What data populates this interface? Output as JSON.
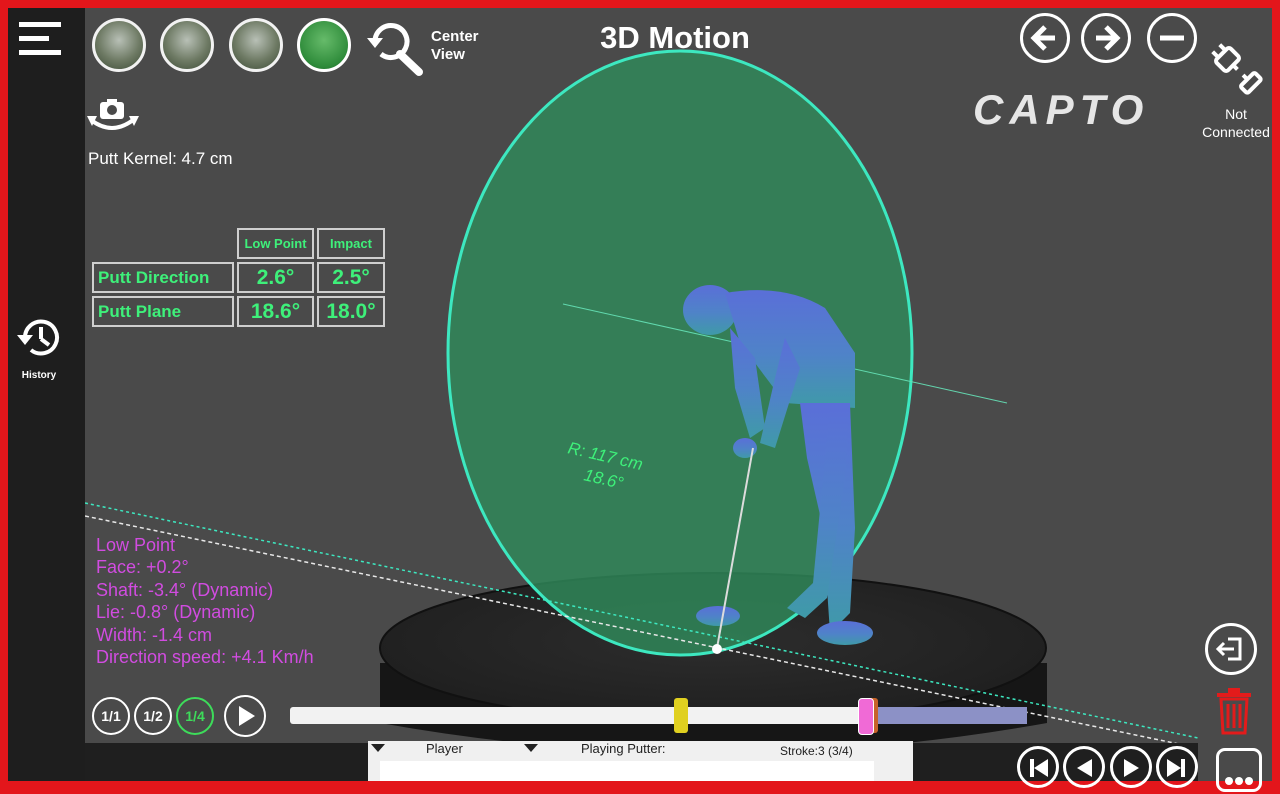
{
  "app": {
    "title": "3D Motion",
    "brand": "CAPTO",
    "connection_status": "Not Connected"
  },
  "toolbar": {
    "center_view_label": "Center View"
  },
  "sidebar": {
    "history_label": "History"
  },
  "readout": {
    "putt_kernel": "Putt Kernel: 4.7 cm"
  },
  "metrics_table": {
    "headers": [
      "Low Point",
      "Impact"
    ],
    "rows": [
      {
        "label": "Putt Direction",
        "values": [
          "2.6°",
          "2.5°"
        ]
      },
      {
        "label": "Putt Plane",
        "values": [
          "18.6°",
          "18.0°"
        ]
      }
    ]
  },
  "plane_annotation": {
    "radius": "R: 117 cm",
    "angle": "18.6°"
  },
  "low_point_info": {
    "title": "Low Point",
    "lines": [
      "Face: +0.2°",
      "Shaft: -3.4° (Dynamic)",
      "Lie: -0.8° (Dynamic)",
      "Width: -1.4 cm",
      "Direction speed: +4.1 Km/h"
    ]
  },
  "playback": {
    "speeds": [
      "1/1",
      "1/2",
      "1/4"
    ],
    "active_speed": "1/4",
    "timeline_position": 0.78
  },
  "bottom_panel": {
    "player_label": "Player",
    "putter_label": "Playing Putter:",
    "stroke_label": "Stroke:3 (3/4)"
  },
  "icons": {
    "menu": "hamburger-menu-icon",
    "camera": "rotate-camera-icon",
    "search": "center-view-search-icon",
    "back": "arrow-left-icon",
    "forward": "arrow-right-icon",
    "remove": "minus-icon",
    "plug": "unplugged-icon",
    "history": "history-clock-icon",
    "exit": "exit-icon",
    "delete": "trash-icon"
  },
  "colors": {
    "plane_fill": "#2f8a5a",
    "plane_edge": "#3de8c0",
    "metric_text": "#3ef07a",
    "info_text": "#d14ce0",
    "frame": "#e3161b"
  }
}
